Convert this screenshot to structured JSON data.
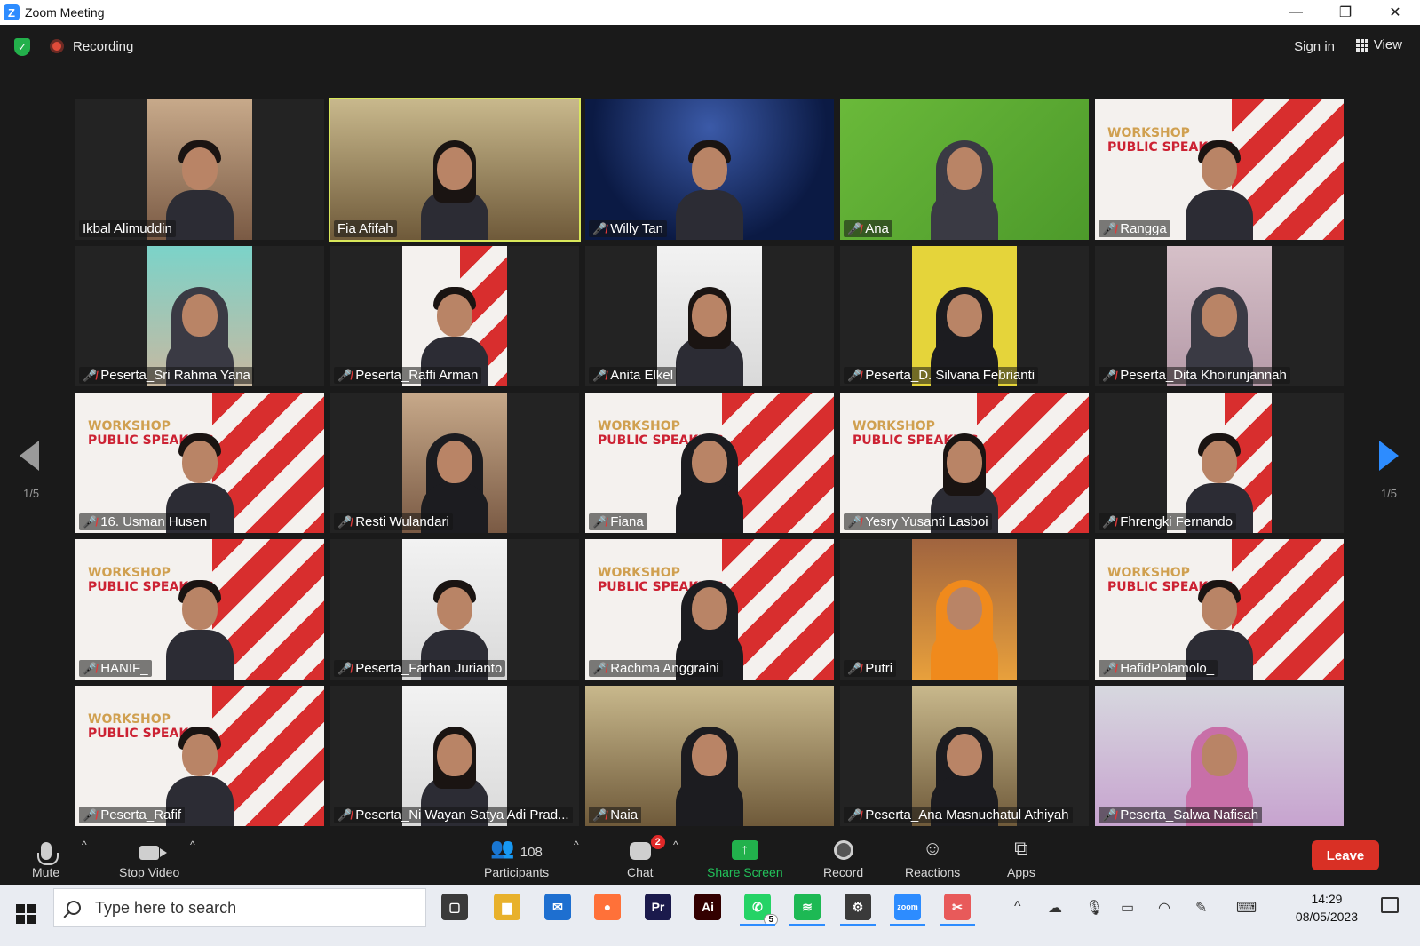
{
  "window": {
    "title": "Zoom Meeting"
  },
  "topbar": {
    "recording_label": "Recording",
    "sign_in_label": "Sign in",
    "view_label": "View"
  },
  "pagination": {
    "left": "1/5",
    "right": "1/5"
  },
  "participants": [
    {
      "name": "Ikbal Alimuddin",
      "muted": false,
      "feed": "warm",
      "style": "male"
    },
    {
      "name": "Fia Afifah",
      "muted": false,
      "feed": "room",
      "style": "female-hair",
      "active": true,
      "full": true
    },
    {
      "name": "Willy Tan",
      "muted": true,
      "feed": "stage",
      "style": "male",
      "full": true
    },
    {
      "name": "Ana",
      "muted": true,
      "feed": "green",
      "style": "hijab",
      "full": true
    },
    {
      "name": "Rangga",
      "muted": true,
      "feed": "banner",
      "style": "male",
      "full": true
    },
    {
      "name": "Peserta_Sri Rahma Yana",
      "muted": true,
      "feed": "teal",
      "style": "hijab"
    },
    {
      "name": "Peserta_Raffi Arman",
      "muted": true,
      "feed": "banner",
      "style": "male"
    },
    {
      "name": "Anita Elkel",
      "muted": true,
      "feed": "white",
      "style": "female-hair"
    },
    {
      "name": "Peserta_D. Silvana Febrianti",
      "muted": true,
      "feed": "yellow",
      "style": "hijab"
    },
    {
      "name": "Peserta_Dita Khoirunjannah",
      "muted": true,
      "feed": "pink",
      "style": "hijab"
    },
    {
      "name": "16. Usman Husen",
      "muted": true,
      "feed": "banner",
      "style": "male",
      "full": true
    },
    {
      "name": "Resti Wulandari",
      "muted": true,
      "feed": "warm",
      "style": "hijab"
    },
    {
      "name": "Fiana",
      "muted": true,
      "feed": "banner",
      "style": "hijab",
      "full": true
    },
    {
      "name": "Yesry Yusanti Lasboi",
      "muted": true,
      "feed": "banner",
      "style": "female-hair",
      "full": true
    },
    {
      "name": "Fhrengki Fernando",
      "muted": true,
      "feed": "banner",
      "style": "male"
    },
    {
      "name": "HANIF_",
      "muted": true,
      "feed": "banner",
      "style": "male",
      "full": true
    },
    {
      "name": "Peserta_Farhan Jurianto",
      "muted": true,
      "feed": "white",
      "style": "male"
    },
    {
      "name": "Rachma Anggraini",
      "muted": true,
      "feed": "banner",
      "style": "hijab",
      "full": true
    },
    {
      "name": "Putri",
      "muted": true,
      "feed": "brick",
      "style": "hijab-orange"
    },
    {
      "name": "HafidPolamolo_",
      "muted": true,
      "feed": "banner",
      "style": "male",
      "full": true
    },
    {
      "name": "Peserta_Rafif",
      "muted": true,
      "feed": "banner",
      "style": "male",
      "full": true
    },
    {
      "name": "Peserta_Ni Wayan Satya Adi Prad...",
      "muted": true,
      "feed": "white",
      "style": "female-hair"
    },
    {
      "name": "Naia",
      "muted": true,
      "feed": "room",
      "style": "hijab",
      "full": true
    },
    {
      "name": "Peserta_Ana Masnuchatul Athiyah",
      "muted": true,
      "feed": "room",
      "style": "hijab"
    },
    {
      "name": "Peserta_Salwa Nafisah",
      "muted": true,
      "feed": "lilac",
      "style": "hijab-pink",
      "full": true
    }
  ],
  "banner": {
    "line1": "WORKSHOP",
    "line2": "PUBLIC SPEAKING"
  },
  "toolbar": {
    "mute_label": "Mute",
    "stop_video_label": "Stop Video",
    "participants_count": "108",
    "participants_label": "Participants",
    "chat_badge": "2",
    "chat_label": "Chat",
    "share_label": "Share Screen",
    "record_label": "Record",
    "reactions_label": "Reactions",
    "apps_label": "Apps",
    "leave_label": "Leave"
  },
  "taskbar": {
    "search_placeholder": "Type here to search",
    "whatsapp_badge": "5",
    "time": "14:29",
    "date": "08/05/2023",
    "apps": [
      {
        "name": "task-view-icon",
        "color": "#3a3a3a",
        "glyph": "▢"
      },
      {
        "name": "file-explorer-icon",
        "color": "#e8b12c",
        "glyph": "▆"
      },
      {
        "name": "mail-icon",
        "color": "#1e6fd0",
        "glyph": "✉"
      },
      {
        "name": "firefox-icon",
        "color": "#ff7139",
        "glyph": "●"
      },
      {
        "name": "premiere-pro-icon",
        "color": "#1b1a4c",
        "glyph": "Pr"
      },
      {
        "name": "illustrator-icon",
        "color": "#330000",
        "glyph": "Ai"
      },
      {
        "name": "whatsapp-icon",
        "color": "#25d366",
        "glyph": "✆"
      },
      {
        "name": "spotify-icon",
        "color": "#1db954",
        "glyph": "≋"
      },
      {
        "name": "settings-icon",
        "color": "#3a3a3a",
        "glyph": "⚙"
      },
      {
        "name": "zoom-icon",
        "color": "#2d8cff",
        "glyph": "zoom"
      },
      {
        "name": "snipping-tool-icon",
        "color": "#e85a5a",
        "glyph": "✂"
      }
    ]
  },
  "colors": {
    "accent": "#2d8cff",
    "leave": "#d93025",
    "share": "#22b14c",
    "active_border": "#d9e85a",
    "muted": "#e03a3a"
  }
}
